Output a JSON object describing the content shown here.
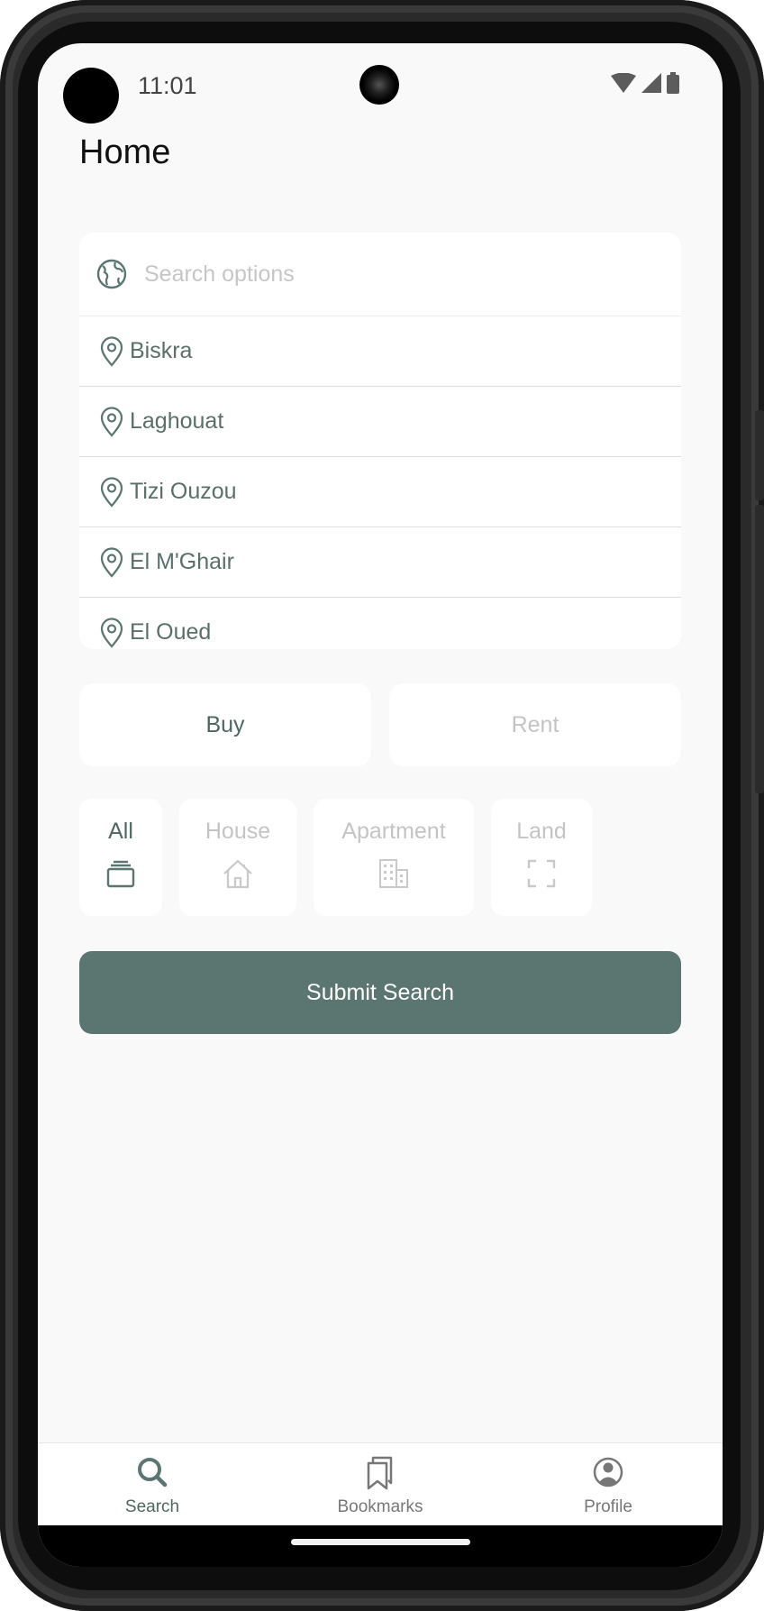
{
  "status_bar": {
    "time": "11:01"
  },
  "page": {
    "title": "Home"
  },
  "search": {
    "placeholder": "Search options",
    "locations": [
      "Biskra",
      "Laghouat",
      "Tizi Ouzou",
      "El M'Ghair",
      "El Oued"
    ]
  },
  "transaction": {
    "buy_label": "Buy",
    "rent_label": "Rent",
    "selected": "Buy"
  },
  "property_types": {
    "selected": "All",
    "items": [
      {
        "label": "All",
        "icon": "stack-icon"
      },
      {
        "label": "House",
        "icon": "house-icon"
      },
      {
        "label": "Apartment",
        "icon": "building-icon"
      },
      {
        "label": "Land",
        "icon": "area-frame-icon"
      }
    ]
  },
  "submit": {
    "label": "Submit Search"
  },
  "bottom_nav": {
    "selected": "Search",
    "items": [
      {
        "label": "Search",
        "icon": "search-icon"
      },
      {
        "label": "Bookmarks",
        "icon": "bookmarks-icon"
      },
      {
        "label": "Profile",
        "icon": "profile-icon"
      }
    ]
  },
  "colors": {
    "accent": "#5b7670",
    "accent_text": "#4f6661",
    "inactive_text": "#c4c4c4",
    "background": "#f9f9f9"
  }
}
